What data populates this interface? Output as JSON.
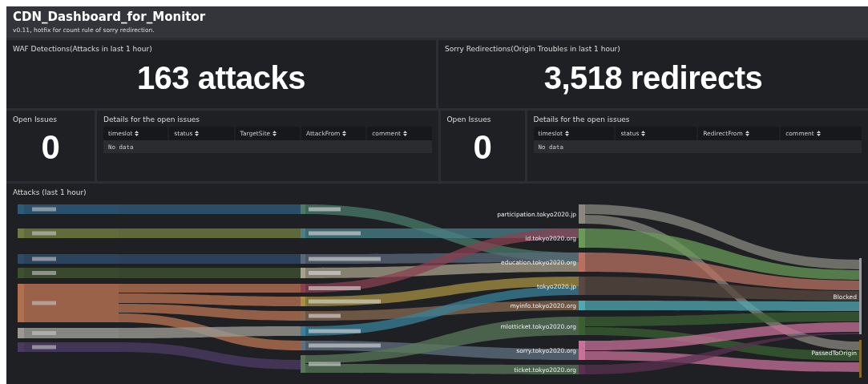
{
  "dashboard": {
    "title": "CDN_Dashboard_for_Monitor",
    "subtitle": "v0.11, hotfix for count rule of sorry redirection."
  },
  "summaries": [
    {
      "title": "WAF Detections(Attacks in last 1 hour)",
      "value": "163 attacks"
    },
    {
      "title": "Sorry Redirections(Origin Troubles in last 1 hour)",
      "value": "3,518 redirects"
    }
  ],
  "issues": [
    {
      "open_title": "Open Issues",
      "count": "0",
      "details_title": "Details for the open issues",
      "columns": [
        "timeslot",
        "status",
        "TargetSite",
        "AttackFrom",
        "comment"
      ],
      "empty_text": "No data"
    },
    {
      "open_title": "Open Issues",
      "count": "0",
      "details_title": "Details for the open issues",
      "columns": [
        "timeslot",
        "status",
        "RedirectFrom",
        "comment"
      ],
      "empty_text": "No data"
    }
  ],
  "attacks": {
    "title": "Attacks (last 1 hour)",
    "sites": [
      {
        "label": "participation.tokyo2020.jp",
        "color": "#8a8880"
      },
      {
        "label": "id.tokyo2020.org",
        "color": "#6a9a58"
      },
      {
        "label": "education.tokyo2020.org",
        "color": "#b87060"
      },
      {
        "label": "tokyo2020.jp",
        "color": "#5a4840"
      },
      {
        "label": "myinfo.tokyo2020.org",
        "color": "#50a8b0"
      },
      {
        "label": "mlotticket.tokyo2020.org",
        "color": "#3a6030"
      },
      {
        "label": "sorry.tokyo2020.org",
        "color": "#c87098"
      },
      {
        "label": "ticket.tokyo2020.org",
        "color": "#5a3050"
      }
    ],
    "outcomes": [
      {
        "label": "Blocked",
        "color": "#9a9aa0"
      },
      {
        "label": "PassedToOrigin",
        "color": "#8a6a30"
      }
    ]
  }
}
